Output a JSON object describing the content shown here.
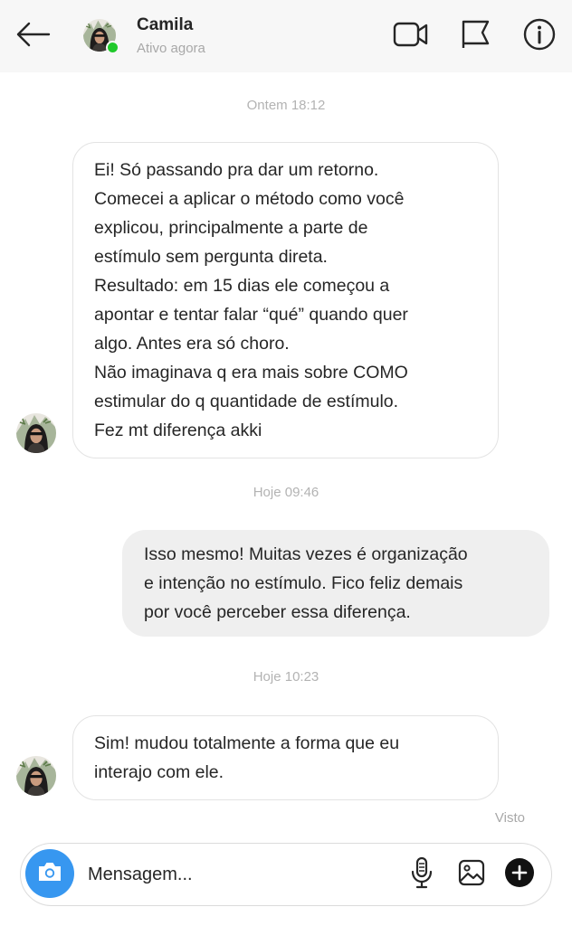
{
  "header": {
    "contact_name": "Camila",
    "status": "Ativo agora",
    "status_color": "#20c92b",
    "icons": [
      "back-arrow-icon",
      "video-camera-icon",
      "flag-icon",
      "info-icon"
    ]
  },
  "conversation": {
    "timestamps": [
      "Ontem 18:12",
      "Hoje 09:46",
      "Hoje 10:23"
    ],
    "messages": [
      {
        "direction": "incoming",
        "lines": [
          "Ei! Só passando pra dar um retorno.",
          "Comecei a aplicar o método como você",
          "explicou, principalmente a parte de",
          "estímulo sem pergunta direta.",
          "Resultado: em 15 dias ele começou a",
          "apontar e tentar falar “qué” quando quer",
          "algo. Antes era só choro.",
          "Não imaginava q era mais sobre COMO",
          "estimular do q quantidade de estímulo.",
          "Fez mt diferença akki"
        ]
      },
      {
        "direction": "outgoing",
        "lines": [
          "Isso mesmo! Muitas vezes é organização",
          "e intenção no estímulo. Fico feliz demais",
          "por você perceber essa diferença."
        ]
      },
      {
        "direction": "incoming",
        "lines": [
          "Sim! mudou totalmente a forma que eu",
          "interajo com ele."
        ]
      }
    ],
    "seen_label": "Visto"
  },
  "composer": {
    "placeholder": "Mensagem...",
    "icons": [
      "camera-icon",
      "microphone-icon",
      "gallery-icon",
      "plus-icon"
    ],
    "camera_color": "#3797f0"
  }
}
